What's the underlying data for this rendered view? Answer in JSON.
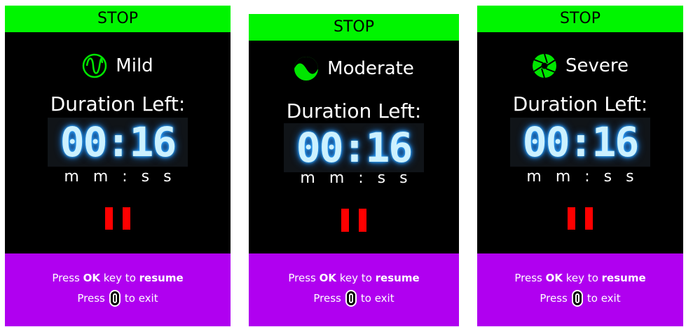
{
  "colors": {
    "stop_bar": "#00f500",
    "screen_bg": "#000000",
    "bottom_bar": "#b000f0",
    "pause": "#ff0000",
    "icon_green": "#00e600",
    "timer_glow": "#2ea8ff"
  },
  "panels": [
    {
      "stop_label": "STOP",
      "mode": {
        "label": "Mild",
        "icon": "sine-wave-icon"
      },
      "duration_label": "Duration Left:",
      "timer": "00:16",
      "units": [
        "m",
        "m",
        ":",
        "s",
        "s"
      ],
      "pause_icon": "pause-icon",
      "footer": {
        "press": "Press",
        "ok": "OK",
        "key_to": "key to",
        "resume": "resume",
        "press2": "Press",
        "to_exit": "to exit"
      }
    },
    {
      "stop_label": "STOP",
      "mode": {
        "label": "Moderate",
        "icon": "wave-circle-icon"
      },
      "duration_label": "Duration Left:",
      "timer": "00:16",
      "units": [
        "m",
        "m",
        ":",
        "s",
        "s"
      ],
      "pause_icon": "pause-icon",
      "footer": {
        "press": "Press",
        "ok": "OK",
        "key_to": "key to",
        "resume": "resume",
        "press2": "Press",
        "to_exit": "to exit"
      }
    },
    {
      "stop_label": "STOP",
      "mode": {
        "label": "Severe",
        "icon": "aperture-icon"
      },
      "duration_label": "Duration Left:",
      "timer": "00:16",
      "units": [
        "m",
        "m",
        ":",
        "s",
        "s"
      ],
      "pause_icon": "pause-icon",
      "footer": {
        "press": "Press",
        "ok": "OK",
        "key_to": "key to",
        "resume": "resume",
        "press2": "Press",
        "to_exit": "to exit"
      }
    }
  ]
}
